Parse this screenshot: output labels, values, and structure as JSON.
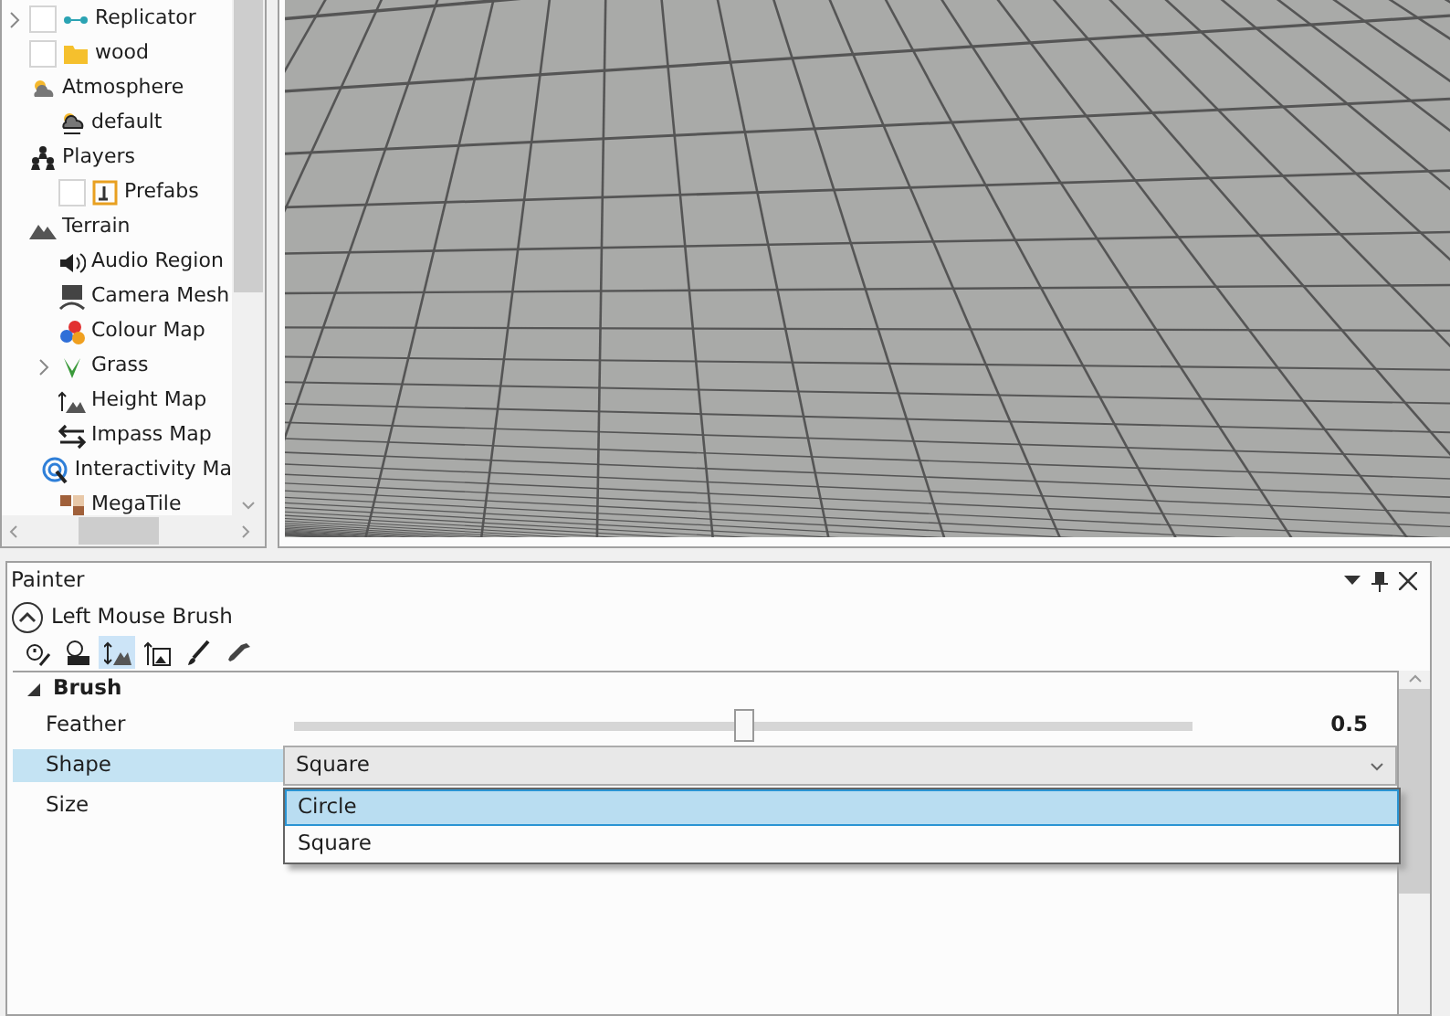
{
  "tree": [
    {
      "label": "Replicator",
      "expanded": false,
      "checked": false
    },
    {
      "label": "wood",
      "checked": false
    },
    {
      "label": "Atmosphere",
      "expanded": true,
      "children": [
        {
          "label": "default"
        }
      ]
    },
    {
      "label": "Players",
      "expanded": true,
      "children": [
        {
          "label": "Prefabs",
          "checked": false
        }
      ]
    },
    {
      "label": "Terrain",
      "expanded": true,
      "children": [
        {
          "label": "Audio Region"
        },
        {
          "label": "Camera Mesh"
        },
        {
          "label": "Colour Map"
        },
        {
          "label": "Grass",
          "expanded": false
        },
        {
          "label": "Height Map"
        },
        {
          "label": "Impass Map"
        },
        {
          "label": "Interactivity Ma"
        },
        {
          "label": "MegaTile"
        }
      ]
    }
  ],
  "painter": {
    "title": "Painter",
    "brush_title": "Left Mouse Brush",
    "tools": [
      {
        "selected": false
      },
      {
        "selected": false
      },
      {
        "selected": true
      },
      {
        "selected": false
      },
      {
        "selected": false
      },
      {
        "selected": false
      }
    ],
    "category": {
      "label": "Brush",
      "expanded": true
    },
    "properties": [
      {
        "kind": "slider",
        "label": "Feather",
        "level": 0.5,
        "reading": "0.5",
        "selected": false
      },
      {
        "kind": "dropdown",
        "label": "Shape",
        "value": "Square",
        "selected": true,
        "open": true,
        "options": [
          {
            "label": "Circle",
            "highlighted": true
          },
          {
            "label": "Square",
            "highlighted": false
          }
        ]
      },
      {
        "kind": "empty",
        "label": "Size",
        "selected": false
      }
    ]
  }
}
